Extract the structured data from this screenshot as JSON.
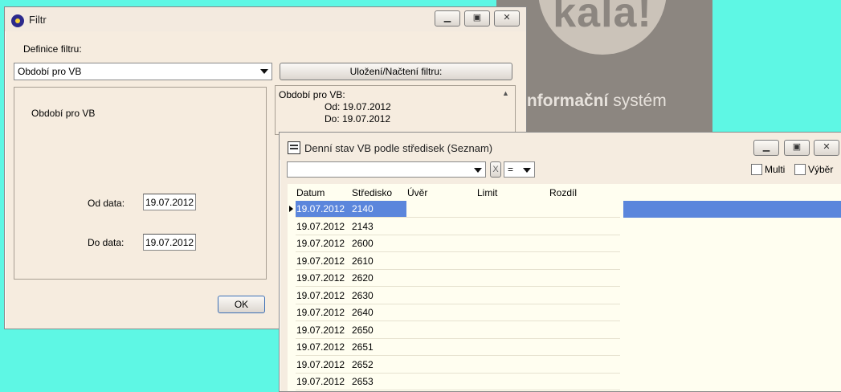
{
  "background": {
    "brand": "kala!",
    "tagline_bold": "informační",
    "tagline_rest": " systém"
  },
  "filtr_window": {
    "title": "Filtr",
    "definition_label": "Definice filtru:",
    "filter_combo_value": "Období pro VB",
    "save_load_button": "Uložení/Načtení filtru:",
    "panel_heading": "Období pro VB",
    "od_label": "Od data:",
    "od_value": "19.07.2012",
    "do_label": "Do data:",
    "do_value": "19.07.2012",
    "summary": {
      "line1": "Období pro VB:",
      "line2": "Od: 19.07.2012",
      "line3": "Do: 19.07.2012"
    },
    "ok_button": "OK"
  },
  "seznam_window": {
    "title": "Denní stav VB podle středisek (Seznam)",
    "operator_value": "=",
    "clear_glyph": "X",
    "multi_label": "Multi",
    "vyber_label": "Výběr",
    "columns": [
      "Datum",
      "Středisko",
      "Úvěr",
      "Limit",
      "Rozdíl"
    ],
    "rows": [
      {
        "datum": "19.07.2012",
        "stredisko": "2140"
      },
      {
        "datum": "19.07.2012",
        "stredisko": "2143"
      },
      {
        "datum": "19.07.2012",
        "stredisko": "2600"
      },
      {
        "datum": "19.07.2012",
        "stredisko": "2610"
      },
      {
        "datum": "19.07.2012",
        "stredisko": "2620"
      },
      {
        "datum": "19.07.2012",
        "stredisko": "2630"
      },
      {
        "datum": "19.07.2012",
        "stredisko": "2640"
      },
      {
        "datum": "19.07.2012",
        "stredisko": "2650"
      },
      {
        "datum": "19.07.2012",
        "stredisko": "2651"
      },
      {
        "datum": "19.07.2012",
        "stredisko": "2652"
      },
      {
        "datum": "19.07.2012",
        "stredisko": "2653"
      }
    ],
    "selected_row": 0
  },
  "colors": {
    "desktop": "#5ef7e4",
    "window_bg": "#f6ecdf",
    "selection": "#5b86dc",
    "grid_bg": "#fffef0"
  }
}
